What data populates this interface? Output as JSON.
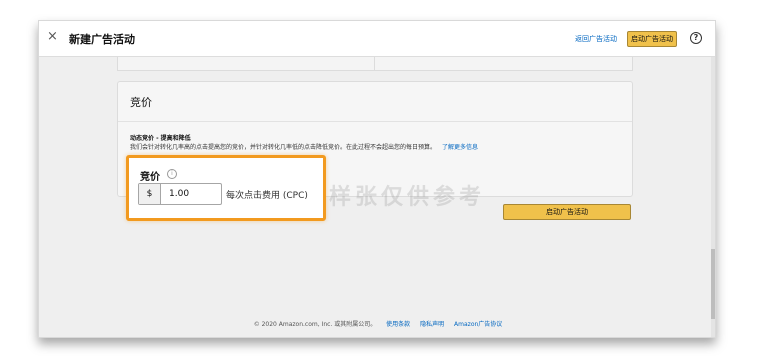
{
  "header": {
    "title": "新建广告活动",
    "back_label": "返回广告活动",
    "launch_label": "启动广告活动",
    "help_glyph": "?",
    "close_glyph": "×"
  },
  "bidding_card": {
    "title": "竞价",
    "strategy_title": "动态竞价 - 提高和降低",
    "strategy_desc": "我们会针对转化几率高的点击提高您的竞价，并针对转化几率低的点击降低竞价。在此过程不会超出您的每日预算。",
    "learn_more": "了解更多信息"
  },
  "bid_highlight": {
    "label": "竞价",
    "currency": "$",
    "value": "1.00",
    "unit": "每次点击费用 (CPC)",
    "info_glyph": "i",
    "border_color": "#f29a1f"
  },
  "watermark": "样张仅供参考",
  "launch_bottom_label": "启动广告活动",
  "footer": {
    "copyright": "© 2020 Amazon.com, Inc. 或其附属公司。",
    "links": [
      "使用条款",
      "隐私声明",
      "Amazon广告协议"
    ]
  },
  "colors": {
    "accent_button": "#f0c14b",
    "link": "#0066c0"
  }
}
